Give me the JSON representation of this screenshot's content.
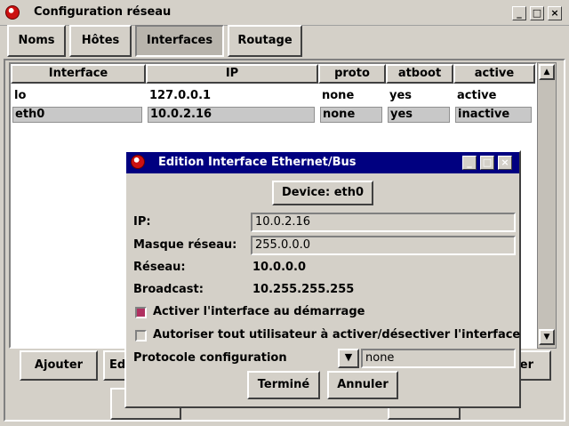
{
  "window": {
    "title": "Configuration réseau"
  },
  "tabs": [
    "Noms",
    "Hôtes",
    "Interfaces",
    "Routage"
  ],
  "table": {
    "headers": [
      "Interface",
      "IP",
      "proto",
      "atboot",
      "active"
    ],
    "rows": [
      [
        "lo",
        "127.0.0.1",
        "none",
        "yes",
        "active"
      ],
      [
        "eth0",
        "10.0.2.16",
        "none",
        "yes",
        "inactive"
      ]
    ]
  },
  "bottom_buttons": {
    "add": "Ajouter",
    "edit_partial": "Ed",
    "right_partial": "er"
  },
  "dialog": {
    "title": "Edition Interface Ethernet/Bus",
    "device_label": "Device: eth0",
    "ip_label": "IP:",
    "ip_value": "10.0.2.16",
    "mask_label": "Masque réseau:",
    "mask_value": "255.0.0.0",
    "network_label": "Réseau:",
    "network_value": "10.0.0.0",
    "broadcast_label": "Broadcast:",
    "broadcast_value": "10.255.255.255",
    "check_boot_label": "Activer l'interface au démarrage",
    "check_users_label": "Autoriser tout utilisateur à activer/désectiver l'interface",
    "protocol_label": "Protocole configuration",
    "protocol_value": "none",
    "done_button": "Terminé",
    "cancel_button": "Annuler"
  },
  "colors": {
    "titlebar_active": "#000080",
    "checkbox_on": "#b03060",
    "background": "#d4d0c8"
  }
}
